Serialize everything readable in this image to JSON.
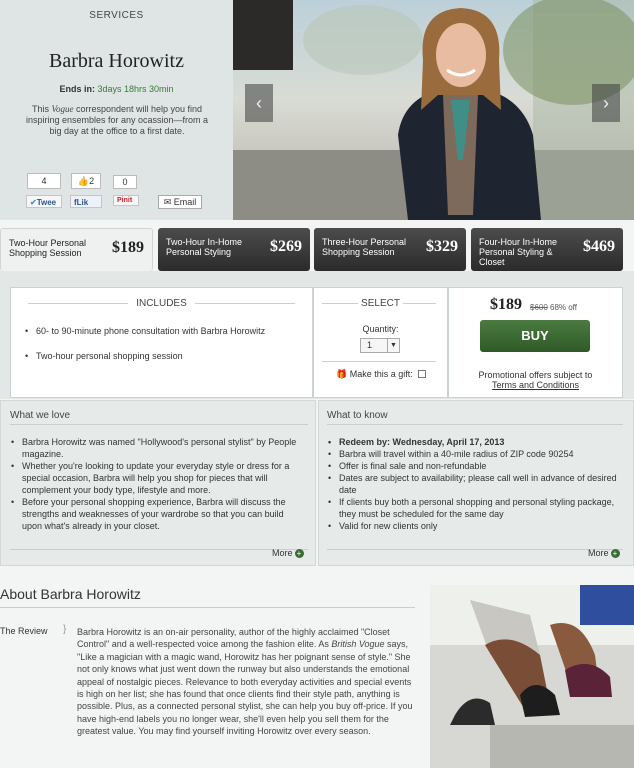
{
  "hero": {
    "label": "SERVICES",
    "name": "Barbra Horowitz",
    "ends_label": "Ends in:",
    "ends_time": "3days 18hrs 30min",
    "desc_pre": "This ",
    "desc_vogue": "Vogue",
    "desc_post": " correspondent will help you find inspiring ensembles for any ocassion—from a big day at the office to a first date.",
    "social": {
      "tweet_count": "4",
      "tweet_label": "Twee",
      "like_count": "2",
      "like_label": "Lik",
      "pin_count": "0",
      "pin_label": "Pinit",
      "email_label": "Email"
    },
    "arrow_prev": "‹",
    "arrow_next": "›"
  },
  "tabs": [
    {
      "name": "Two-Hour Personal Shopping Session",
      "price": "$189"
    },
    {
      "name": "Two-Hour In-Home Personal Styling",
      "price": "$269"
    },
    {
      "name": "Three-Hour Personal Shopping Session",
      "price": "$329"
    },
    {
      "name": "Four-Hour In-Home Personal Styling & Closet",
      "price": "$469"
    }
  ],
  "includes": {
    "title": "INCLUDES",
    "items": [
      "60- to 90-minute phone consultation with Barbra Horowitz",
      "Two-hour personal shopping session"
    ]
  },
  "select": {
    "title": "SELECT",
    "quantity_label": "Quantity:",
    "quantity_value": "1",
    "gift_label": "Make this a gift:"
  },
  "purchase": {
    "price": "$189",
    "original_price": "$600",
    "discount": "68% off",
    "buy_label": "BUY",
    "promo_text": "Promotional offers subject to",
    "terms_link": "Terms and Conditions"
  },
  "love": {
    "title": "What we love",
    "items": [
      "Barbra Horowitz was named \"Hollywood's personal stylist\" by People magazine.",
      "Whether you're looking to update your everyday style or dress for a special occasion, Barbra will help you shop for pieces that will complement your body type, lifestyle and more.",
      "Before your personal shopping experience, Barbra will discuss the strengths and weaknesses of your wardrobe so that you can build upon what's already in your closet."
    ],
    "more": "More"
  },
  "know": {
    "title": "What to know",
    "items": [
      "Redeem by: Wednesday, April 17, 2013",
      "Barbra will travel within a 40-mile radius of ZIP code 90254",
      "Offer is final sale and non-refundable",
      "Dates are subject to availability; please call well in advance of desired date",
      "If clients buy both a personal shopping and personal styling package, they must be scheduled for the same day",
      "Valid for new clients only"
    ],
    "more": "More"
  },
  "about": {
    "title": "About Barbra Horowitz",
    "label": "The Review",
    "text_1": "Barbra Horowitz is an on-air personality, author of the highly acclaimed \"Closet Control\" and a well-respected voice among the fashion elite. As ",
    "text_vogue": "British Vogue",
    "text_2": " says, \"Like a magician with a magic wand, Horowitz has her poignant sense of style.\" She not only knows what just went down the runway but also understands the emotional appeal of nostalgic pieces. Relevance to both everyday activities and special events is high on her list; she has found that once clients find their style path, anything is possible. Plus, as a connected personal stylist, she can help you buy off-price. If you have high-end labels you no longer wear, she'll even help you sell them for the greatest value. You may find yourself inviting Horowitz over every season."
  },
  "colors": {
    "buy_green": "#3b6a32",
    "ends_green": "#3b7a3a",
    "tab_dark": "#333333"
  }
}
